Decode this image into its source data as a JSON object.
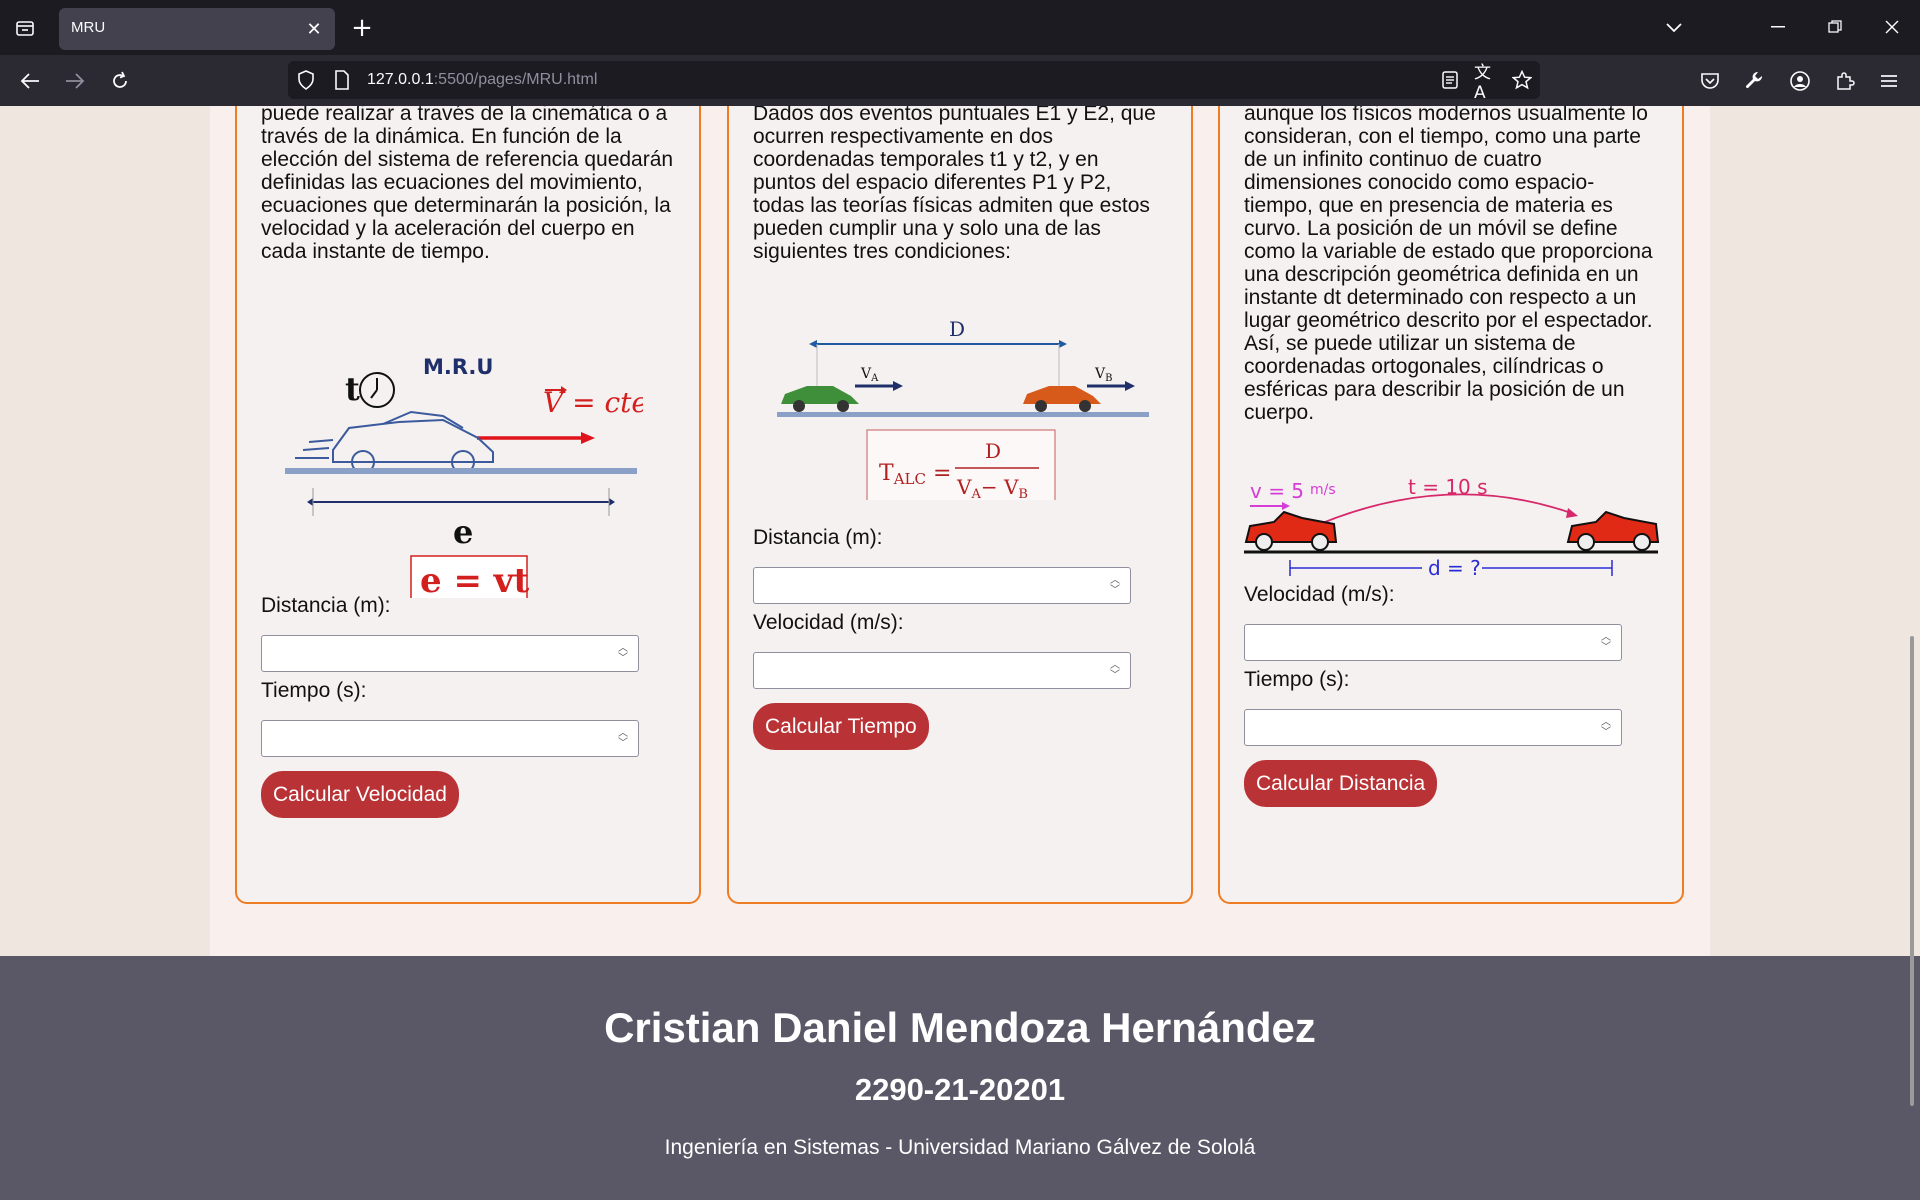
{
  "browser": {
    "tab_title": "MRU",
    "url_host": "127.0.0.1",
    "url_path": ":5500/pages/MRU.html"
  },
  "cards": [
    {
      "text": "puede realizar a través de la cinemática o a través de la dinámica. En función de la elección del sistema de referencia quedarán definidas las ecuaciones del movimiento, ecuaciones que determinarán la posición, la velocidad y la aceleración del cuerpo en cada instante de tiempo.",
      "figure": {
        "t": "t",
        "title": "M.R.U",
        "v_eq": "V = cte",
        "e": "e",
        "formula": "e = vt"
      },
      "label1": "Distancia (m):",
      "label2": "Tiempo (s):",
      "button": "Calcular Velocidad"
    },
    {
      "text": "Dados dos eventos puntuales E1 y E2, que ocurren respectivamente en dos coordenadas temporales t1 y t2, y en puntos del espacio diferentes P1 y P2, todas las teorías físicas admiten que estos pueden cumplir una y solo una de las siguientes tres condiciones:",
      "figure": {
        "d": "D",
        "va": "V",
        "va_sub": "A",
        "vb": "V",
        "vb_sub": "B",
        "t_alc": "T",
        "t_alc_sub": "ALC",
        "num": "D",
        "den": "V",
        "den_a": "A",
        "den_minus": "− V",
        "den_b": "B"
      },
      "label1": "Distancia (m):",
      "label2": "Velocidad (m/s):",
      "button": "Calcular Tiempo"
    },
    {
      "text": "aunque los físicos modernos usualmente lo consideran, con el tiempo, como una parte de un infinito continuo de cuatro dimensiones conocido como espacio-tiempo, que en presencia de materia es curvo. La posición de un móvil se define como la variable de estado que proporciona una descripción geométrica definida en un instante dt determinado con respecto a un lugar geométrico descrito por el espectador. Así, se puede utilizar un sistema de coordenadas ortogonales, cilíndricas o esféricas para describir la posición de un cuerpo.",
      "figure": {
        "v": "v = 5",
        "unit": "m/s",
        "t": "t = 10 s",
        "d": "d = ?"
      },
      "label1": "Velocidad (m/s):",
      "label2": "Tiempo (s):",
      "button": "Calcular Distancia"
    }
  ],
  "footer": {
    "name": "Cristian Daniel Mendoza Hernández",
    "id": "2290-21-20201",
    "subtitle": "Ingeniería en Sistemas - Universidad Mariano Gálvez de Sololá"
  }
}
